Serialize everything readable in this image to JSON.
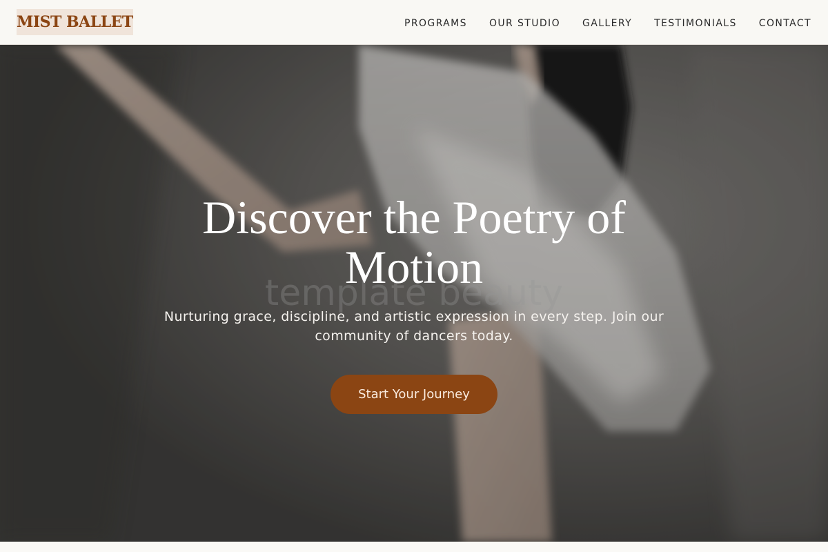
{
  "brand": {
    "logo_text": "MIST BALLET",
    "accent_color": "#8b4513"
  },
  "nav": {
    "items": [
      {
        "label": "PROGRAMS"
      },
      {
        "label": "OUR STUDIO"
      },
      {
        "label": "GALLERY"
      },
      {
        "label": "TESTIMONIALS"
      },
      {
        "label": "CONTACT"
      }
    ]
  },
  "hero": {
    "title": "Discover the Poetry of Motion",
    "subtitle": "Nurturing grace, discipline, and artistic expression in every step. Join our community of dancers today.",
    "cta_label": "Start Your Journey",
    "watermark_text": "template beauty",
    "background_image": "ballet-dancer-photo"
  }
}
